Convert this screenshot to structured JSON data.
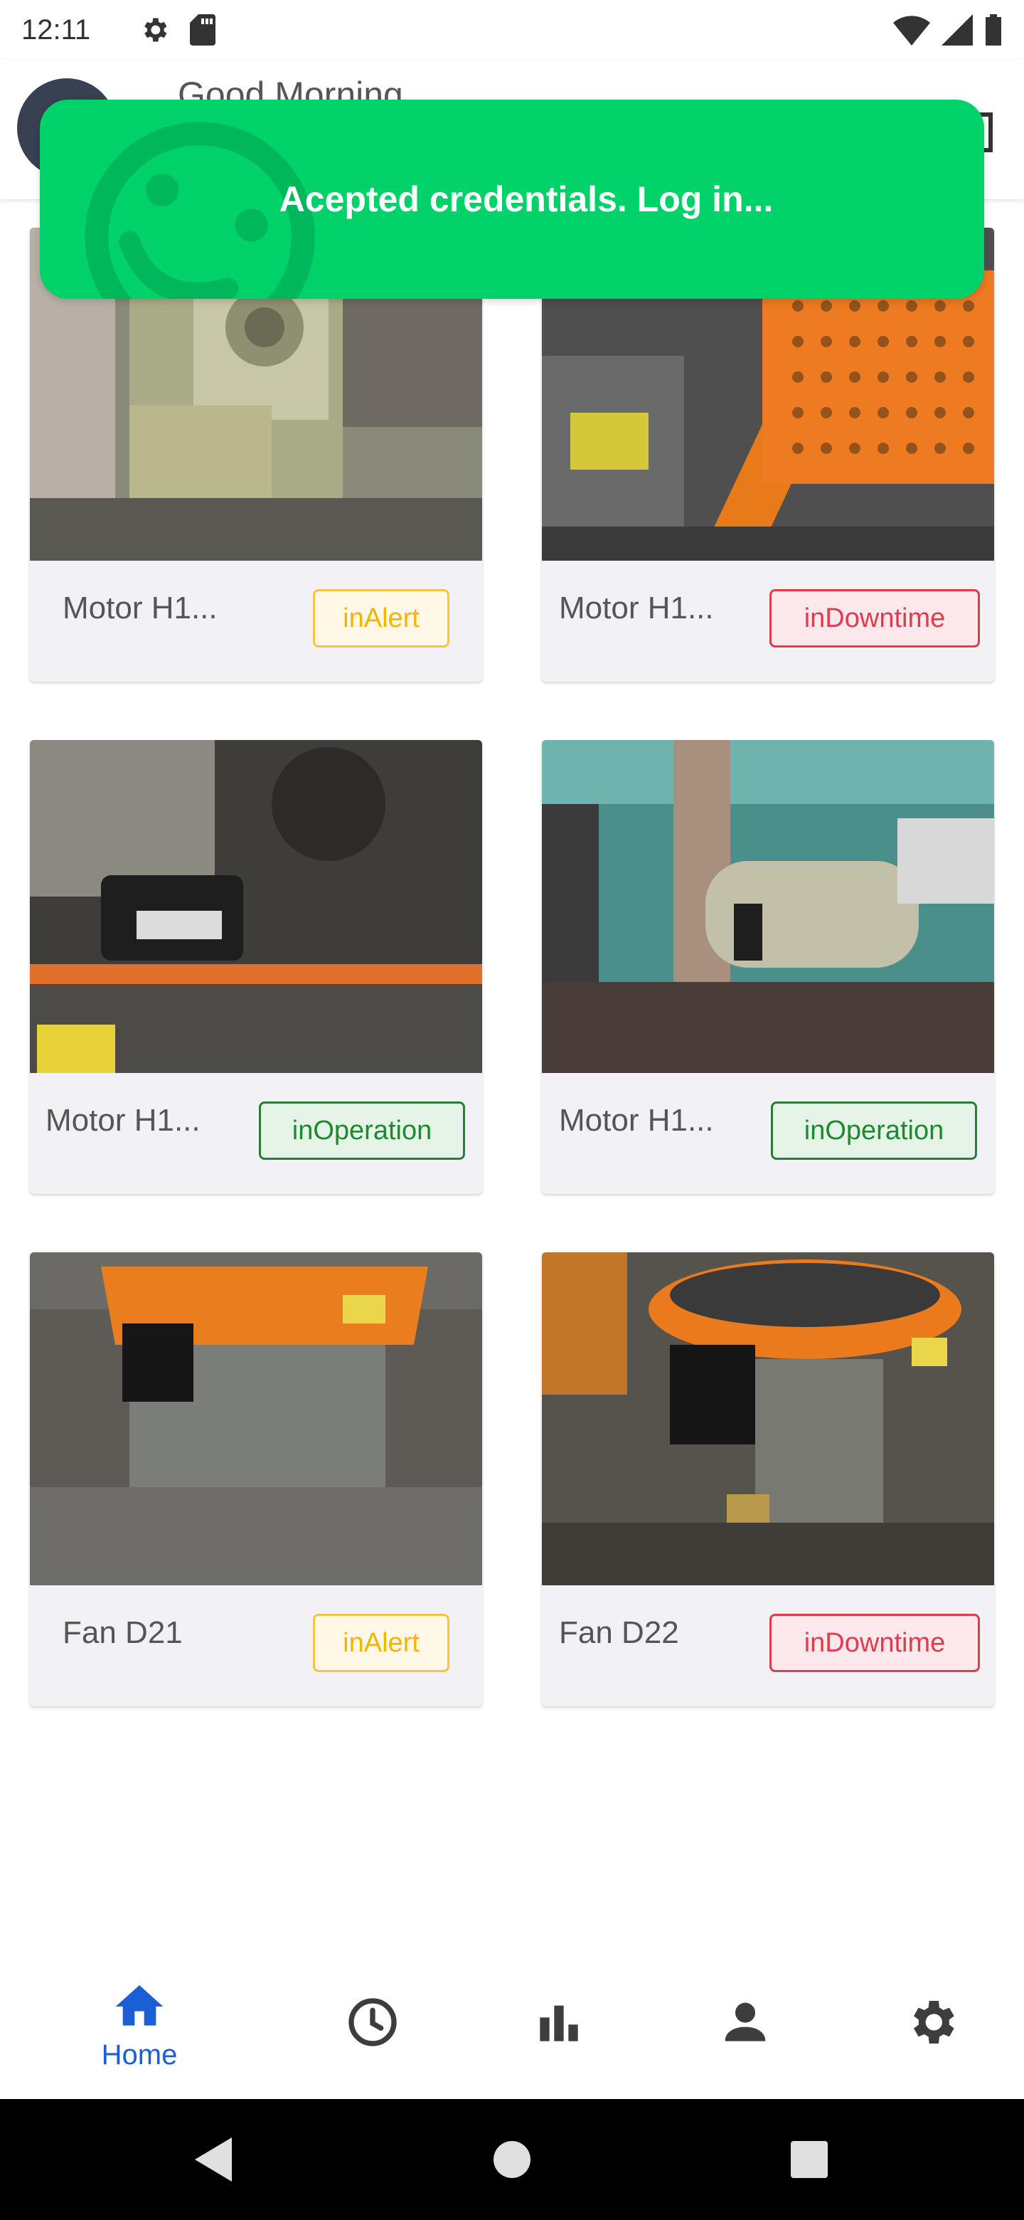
{
  "status_bar": {
    "time": "12:11",
    "icons": [
      "gear-icon",
      "sd-card-icon",
      "wifi-icon",
      "signal-icon",
      "battery-icon"
    ]
  },
  "header": {
    "greeting": "Good Morning"
  },
  "toast": {
    "message": "Acepted credentials. Log in...",
    "color": "#00d26a"
  },
  "assets": [
    {
      "name": "Motor H1...",
      "status": "inAlert",
      "status_type": "alert"
    },
    {
      "name": "Motor H1...",
      "status": "inDowntime",
      "status_type": "downtime"
    },
    {
      "name": "Motor H1...",
      "status": "inOperation",
      "status_type": "operation"
    },
    {
      "name": "Motor H1...",
      "status": "inOperation",
      "status_type": "operation"
    },
    {
      "name": "Fan D21",
      "status": "inAlert",
      "status_type": "alert"
    },
    {
      "name": "Fan D22",
      "status": "inDowntime",
      "status_type": "downtime"
    }
  ],
  "bottom_nav": {
    "items": [
      {
        "icon": "home-icon",
        "label": "Home",
        "active": true
      },
      {
        "icon": "clock-icon",
        "label": "",
        "active": false
      },
      {
        "icon": "bar-chart-icon",
        "label": "",
        "active": false
      },
      {
        "icon": "person-icon",
        "label": "",
        "active": false
      },
      {
        "icon": "gear-icon",
        "label": "",
        "active": false
      }
    ]
  },
  "colors": {
    "accent": "#1a5fd6",
    "alert": "#f5b400",
    "downtime": "#e23b4c",
    "operation": "#1e8a2e"
  }
}
